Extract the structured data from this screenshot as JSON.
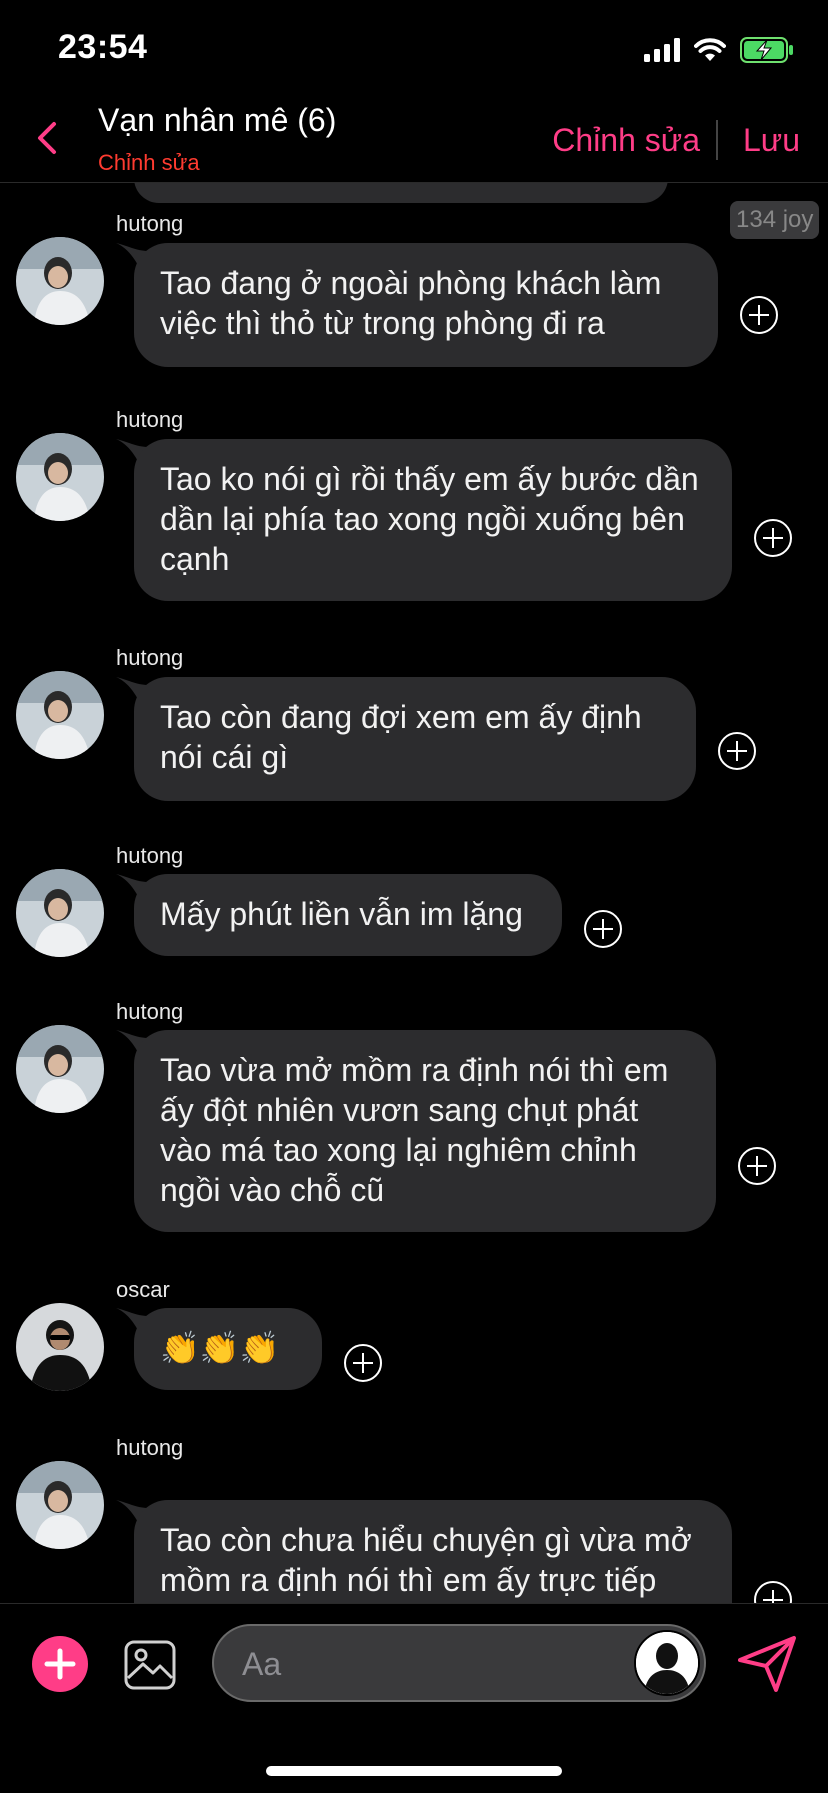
{
  "status_bar": {
    "time": "23:54"
  },
  "header": {
    "title": "Vạn nhân mê (6)",
    "subtitle": "Chỉnh sửa",
    "edit_label": "Chỉnh sửa",
    "save_label": "Lưu"
  },
  "badge": {
    "joy": "134 joy"
  },
  "messages": [
    {
      "sender": "hutong",
      "text": "Tao đang ở ngoài phòng khách làm việc thì thỏ từ trong phòng đi ra"
    },
    {
      "sender": "hutong",
      "text": "Tao ko nói gì rồi thấy em ấy bước dần dần lại phía tao xong ngồi xuống bên cạnh"
    },
    {
      "sender": "hutong",
      "text": "Tao còn đang đợi xem em ấy định nói cái gì"
    },
    {
      "sender": "hutong",
      "text": "Mấy phút liền vẫn im lặng"
    },
    {
      "sender": "hutong",
      "text": "Tao vừa mở mồm ra định nói thì em ấy đột nhiên vươn sang chụt phát vào má tao xong lại nghiêm chỉnh ngồi vào chỗ cũ"
    },
    {
      "sender": "oscar",
      "text": "👏👏👏"
    },
    {
      "sender": "hutong",
      "text": "Tao còn chưa hiểu chuyện gì vừa mở mồm ra định nói thì em ấy trực tiếp"
    }
  ],
  "composer": {
    "placeholder": "Aa"
  },
  "colors": {
    "accent": "#ff3d87",
    "bubble": "#2c2c2e",
    "subtitle": "#ff3b30",
    "background": "#000000"
  },
  "icons": [
    "back-chevron-icon",
    "signal-icon",
    "wifi-icon",
    "battery-charging-icon",
    "add-reaction-icon",
    "plus-icon",
    "image-icon",
    "user-silhouette-icon",
    "send-icon"
  ]
}
